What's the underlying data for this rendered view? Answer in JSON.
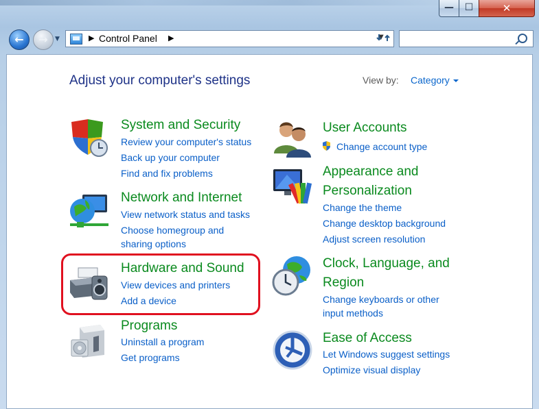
{
  "window": {
    "caption_buttons": {
      "minimize": "—",
      "maximize": "☐",
      "close": "✕"
    }
  },
  "navbar": {
    "back_glyph": "←",
    "forward_glyph": "→",
    "address": "Control Panel",
    "search_placeholder": ""
  },
  "header": {
    "title": "Adjust your computer's settings",
    "view_by_label": "View by:",
    "view_by_value": "Category"
  },
  "categories": {
    "system_security": {
      "title": "System and Security",
      "tasks": [
        "Review your computer's status",
        "Back up your computer",
        "Find and fix problems"
      ]
    },
    "network_internet": {
      "title": "Network and Internet",
      "tasks": [
        "View network status and tasks",
        "Choose homegroup and",
        "sharing options"
      ]
    },
    "hardware_sound": {
      "title": "Hardware and Sound",
      "tasks": [
        "View devices and printers",
        "Add a device"
      ]
    },
    "programs": {
      "title": "Programs",
      "tasks": [
        "Uninstall a program",
        "Get programs"
      ]
    },
    "user_accounts": {
      "title": "User Accounts",
      "tasks": [
        "Change account type"
      ]
    },
    "appearance": {
      "title_line1": "Appearance and",
      "title_line2": "Personalization",
      "tasks": [
        "Change the theme",
        "Change desktop background",
        "Adjust screen resolution"
      ]
    },
    "clock_language": {
      "title_line1": "Clock, Language, and",
      "title_line2": "Region",
      "tasks": [
        "Change keyboards or other",
        "input methods"
      ]
    },
    "ease_of_access": {
      "title": "Ease of Access",
      "tasks": [
        "Let Windows suggest settings",
        "Optimize visual display"
      ]
    }
  },
  "colors": {
    "category_title": "#0a8a1e",
    "task_link": "#0a5fc8",
    "page_title": "#1e3287",
    "highlight": "#e0101f"
  }
}
